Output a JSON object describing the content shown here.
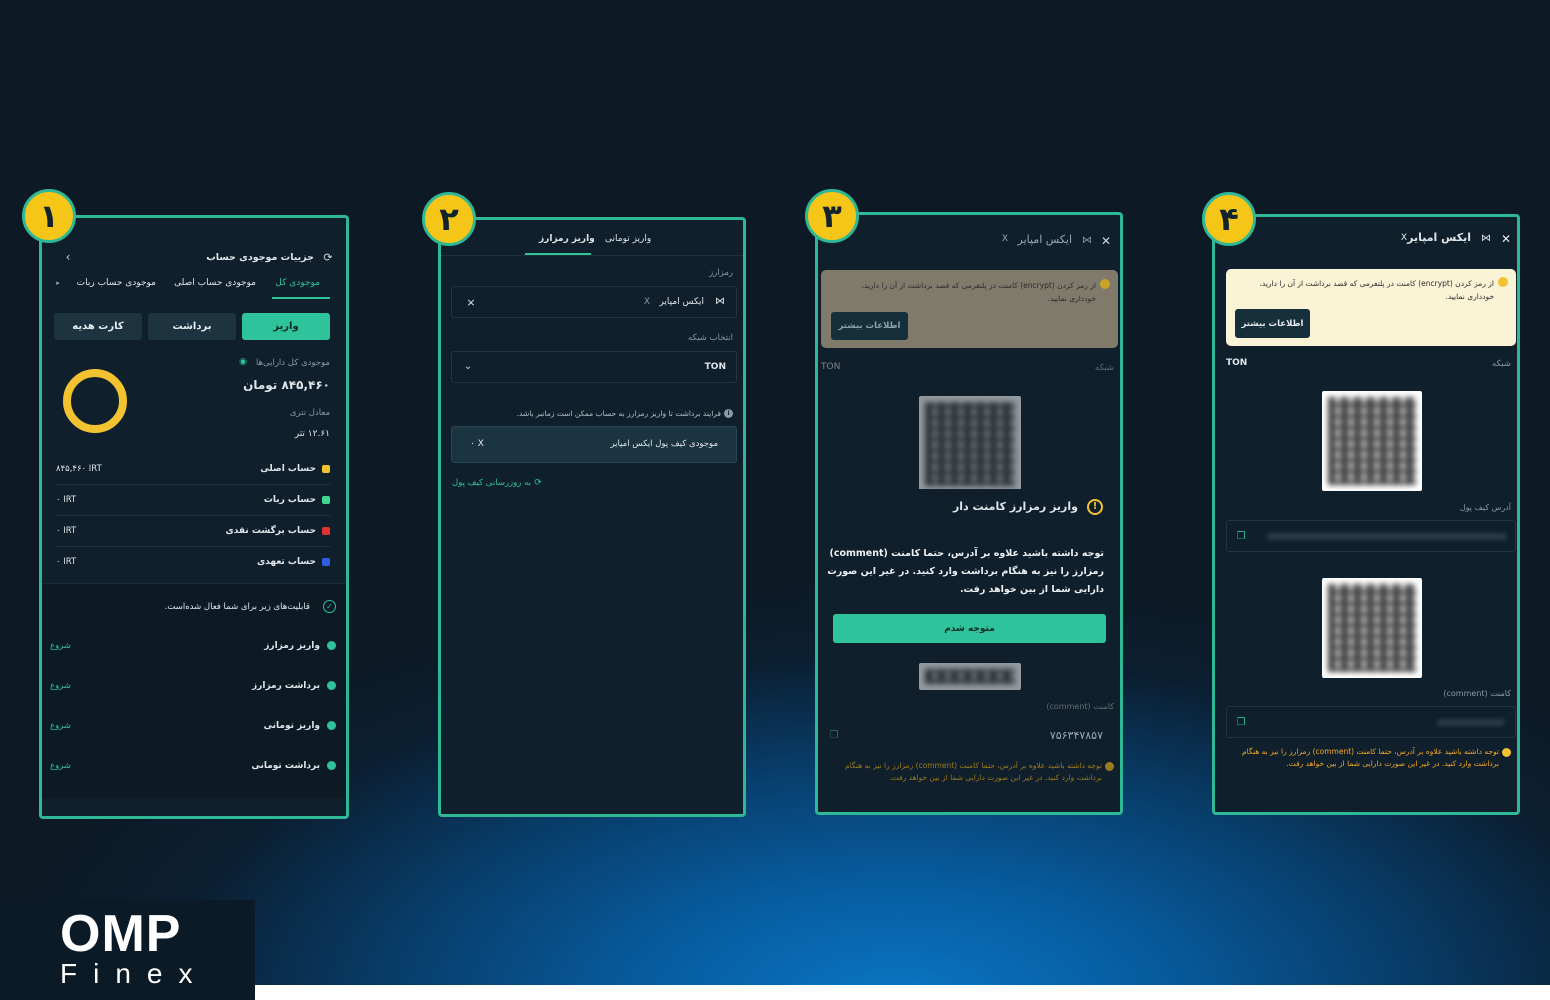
{
  "steps": [
    "۱",
    "۲",
    "۳",
    "۴"
  ],
  "panel1": {
    "title": "جزییات موجودی حساب",
    "tabs": [
      "موجودی کل",
      "موجودی حساب اصلی",
      "موجودی حساب ربات"
    ],
    "buttons": {
      "deposit": "واریز",
      "withdraw": "برداشت",
      "gift": "کارت هدیه"
    },
    "total_label": "موجودی کل دارایی‌ها",
    "total_value": "۸۴۵,۴۶۰ تومان",
    "tether_label": "معادل تتری",
    "tether_value": "۱۲.۶۱ تتر",
    "accounts": [
      {
        "name": "حساب اصلی",
        "value": "۸۴۵,۴۶۰ IRT",
        "color": "#f2c230"
      },
      {
        "name": "حساب ربات",
        "value": "۰ IRT",
        "color": "#3fd68f"
      },
      {
        "name": "حساب برگشت نقدی",
        "value": "۰ IRT",
        "color": "#e0342f"
      },
      {
        "name": "حساب تعهدی",
        "value": "۰ IRT",
        "color": "#2f5fe0"
      }
    ],
    "features_note": "قابلیت‌های زیر برای شما فعال شده‌است.",
    "features": [
      {
        "name": "واریز رمزارز",
        "action": "شروع"
      },
      {
        "name": "برداشت رمزارز",
        "action": "شروع"
      },
      {
        "name": "واریز تومانی",
        "action": "شروع"
      },
      {
        "name": "برداشت تومانی",
        "action": "شروع"
      }
    ],
    "chart_color": "#f2c230"
  },
  "panel2": {
    "tabs": [
      "واریز تومانی",
      "واریز رمزارز"
    ],
    "crypto_label": "رمزارز",
    "crypto_value": "ایکس امپایر",
    "crypto_symbol": "X",
    "network_label": "انتخاب شبکه",
    "network_value": "TON",
    "info_text": "فرایند برداشت تا واریز رمزارز به حساب ممکن است زمانبر باشد.",
    "wallet_label": "موجودی کیف پول ایکس امپایر",
    "wallet_value": "۰ X",
    "refresh_link": "به روزرسانی کیف پول"
  },
  "panel3": {
    "header": "ایکس امپایر",
    "header_symbol": "X",
    "warn_text": "از رمز کردن (encrypt) کامنت در پلتفرمی که قصد برداشت از آن را دارید، خودداری نمایید.",
    "warn_btn": "اطلاعات بیشتر",
    "network_label": "شبکه",
    "network_value": "TON",
    "modal_title": "واریز رمزارز کامنت دار",
    "modal_body": "توجه داشته باشید علاوه بر آدرس، حتما کامنت (comment) رمزارز را نیز به هنگام برداشت وارد کنید. در غیر این صورت دارایی شما از بین خواهد رفت.",
    "modal_btn": "متوجه شدم",
    "comment_label": "کامنت (comment)",
    "comment_value": "۷۵۶۳۴۷۸۵۷",
    "bottom_note": "توجه داشته باشید علاوه بر آدرس، حتما کامنت (comment) رمزارز را نیز به هنگام برداشت وارد کنید. در غیر این صورت دارایی شما از بین خواهد رفت."
  },
  "panel4": {
    "header": "ایکس امپایر",
    "header_symbol": "X",
    "warn_text": "از رمز کردن (encrypt) کامنت در پلتفرمی که قصد برداشت از آن را دارید، خودداری نمایید.",
    "warn_btn": "اطلاعات بیشتر",
    "network_label": "شبکه",
    "network_value": "TON",
    "address_label": "آدرس کیف پول",
    "comment_label": "کامنت (comment)",
    "bottom_note": "توجه داشته باشید علاوه بر آدرس، حتما کامنت (comment) رمزارز را نیز به هنگام برداشت وارد کنید. در غیر این صورت دارایی شما از بین خواهد رفت."
  },
  "logo": {
    "top": "OMP",
    "bottom": "Finex"
  },
  "colors": {
    "accent": "#2fc39b",
    "badge": "#f5c518",
    "warning": "#f2c230",
    "border": "#2fb895"
  }
}
